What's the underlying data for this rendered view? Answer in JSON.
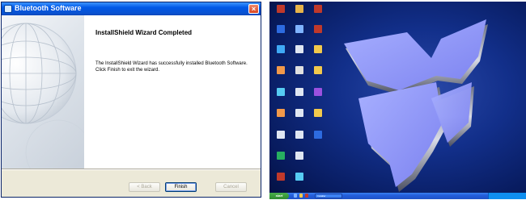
{
  "dialog": {
    "title": "Bluetooth Software",
    "heading": "InstallShield Wizard Completed",
    "message": "The InstallShield Wizard has successfully installed Bluetooth Software. Click Finish to exit the wizard.",
    "buttons": {
      "back": "< Back",
      "finish": "Finish",
      "cancel": "Cancel"
    }
  },
  "desktop": {
    "taskbar": {
      "start_label": "start",
      "task_item": "Installer"
    },
    "icons": [
      {
        "icon": "program-icon",
        "color": "#c0392b"
      },
      {
        "icon": "program-icon",
        "color": "#e6b34a"
      },
      {
        "icon": "document-icon",
        "color": "#c0392b"
      },
      {
        "icon": "program-icon",
        "color": "#2d6be0"
      },
      {
        "icon": "program-icon",
        "color": "#7fb3ff"
      },
      {
        "icon": "document-icon",
        "color": "#c0392b"
      },
      {
        "icon": "program-icon",
        "color": "#3fa9f5"
      },
      {
        "icon": "document-icon",
        "color": "#dfe6f2"
      },
      {
        "icon": "folder-icon",
        "color": "#f2c94c"
      },
      {
        "icon": "program-icon",
        "color": "#f2994a"
      },
      {
        "icon": "program-icon",
        "color": "#e0e0e0"
      },
      {
        "icon": "folder-icon",
        "color": "#f2c94c"
      },
      {
        "icon": "program-icon",
        "color": "#56ccf2"
      },
      {
        "icon": "document-icon",
        "color": "#dfe6f2"
      },
      {
        "icon": "program-icon",
        "color": "#9b51e0"
      },
      {
        "icon": "program-icon",
        "color": "#f2994a"
      },
      {
        "icon": "document-icon",
        "color": "#dfe6f2"
      },
      {
        "icon": "folder-icon",
        "color": "#f2c94c"
      },
      {
        "icon": "document-icon",
        "color": "#dfe6f2"
      },
      {
        "icon": "document-icon",
        "color": "#dfe6f2"
      },
      {
        "icon": "bluetooth-icon",
        "color": "#2d6be0"
      },
      {
        "icon": "program-icon",
        "color": "#27ae60"
      },
      {
        "icon": "document-icon",
        "color": "#dfe6f2"
      },
      {
        "icon": "document-icon",
        "color": "#c0392b"
      },
      {
        "icon": "program-icon",
        "color": "#56ccf2"
      }
    ]
  }
}
